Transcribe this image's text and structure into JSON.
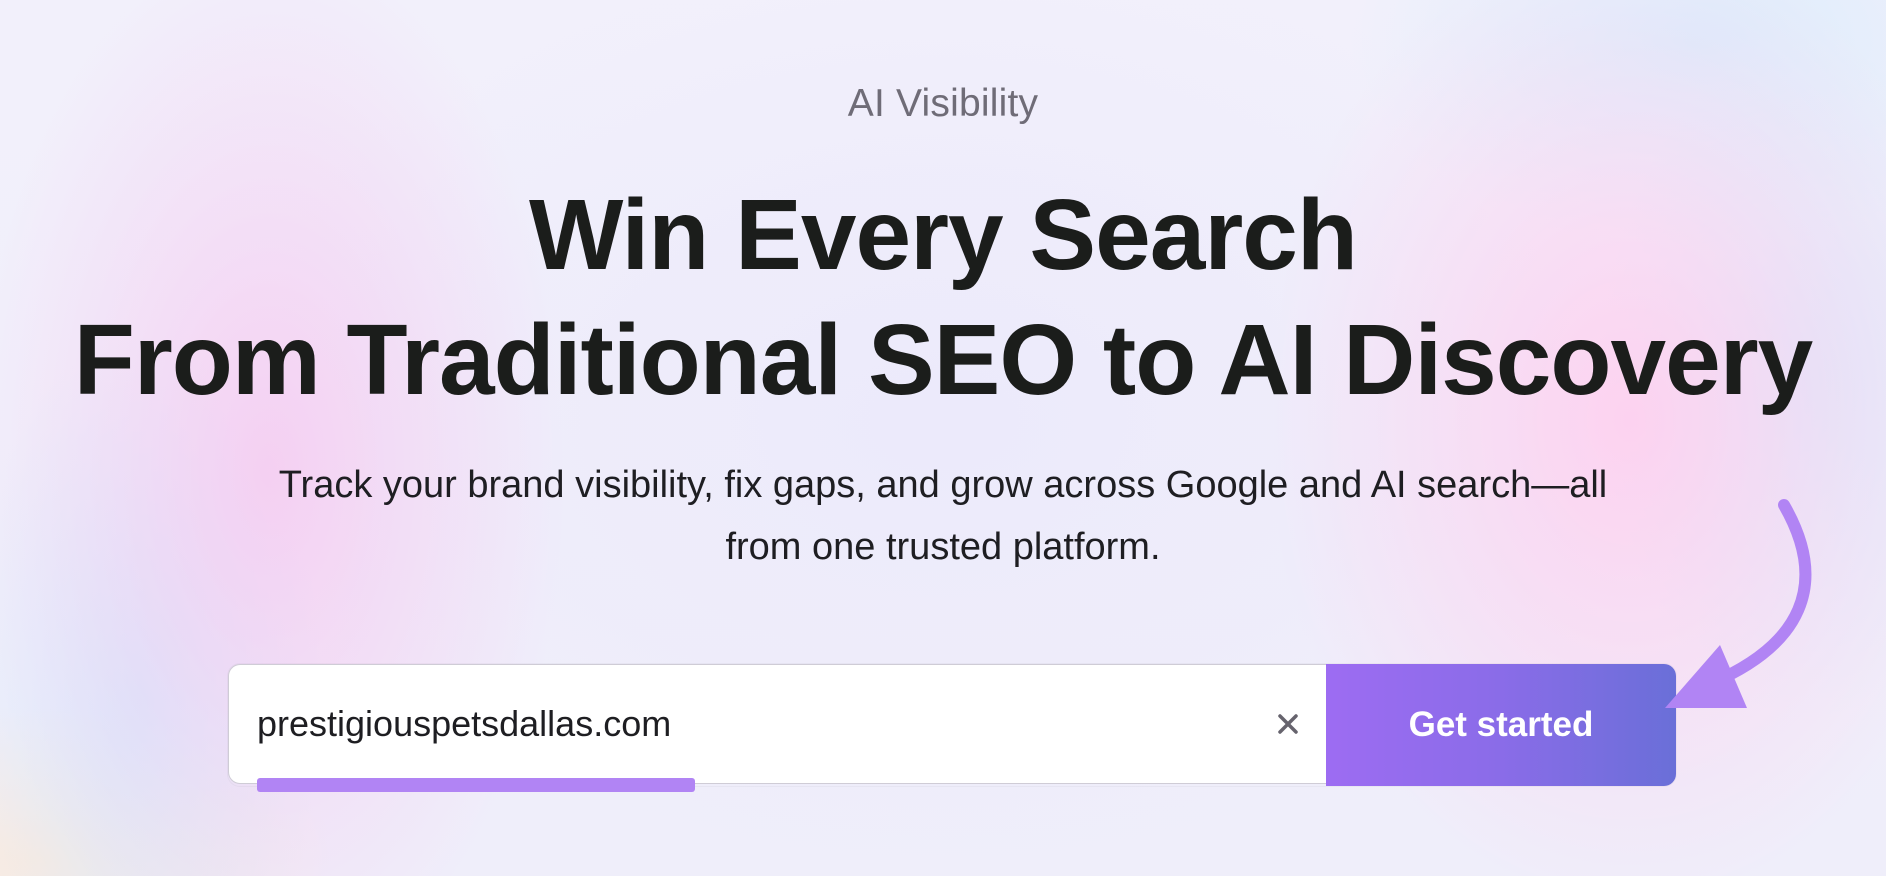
{
  "hero": {
    "eyebrow": "AI Visibility",
    "headline_line1": "Win Every Search",
    "headline_line2": "From Traditional SEO to AI Discovery",
    "subtitle_line1": "Track your brand visibility, fix gaps, and grow across Google and AI search—all",
    "subtitle_line2": "from one trusted platform."
  },
  "search": {
    "value": "prestigiouspetsdallas.com",
    "button_label": "Get started",
    "clear_icon": "close-icon"
  },
  "colors": {
    "accent": "#9d6cf2",
    "button_gradient_end": "#6a6fd8",
    "annotation": "#b184f4",
    "headline": "#1b1d1b"
  }
}
